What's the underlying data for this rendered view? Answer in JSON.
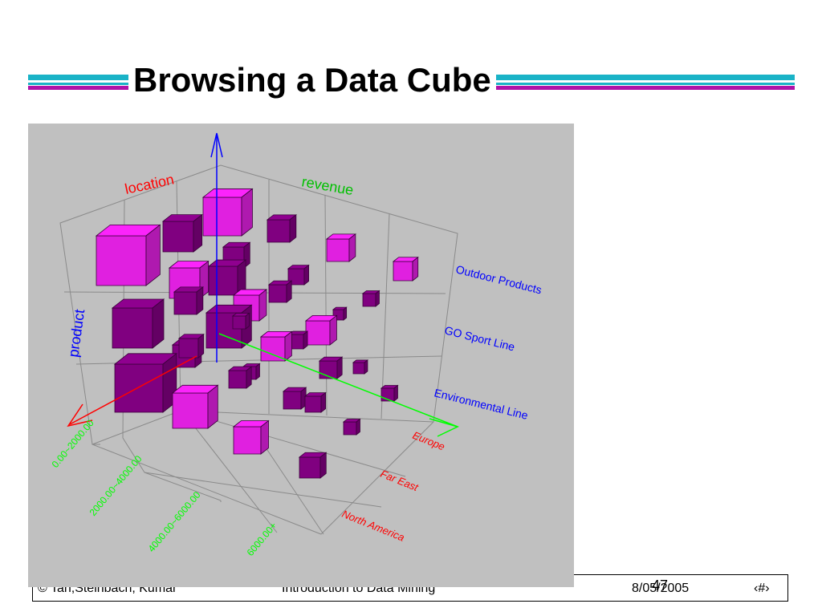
{
  "slide": {
    "title": "Browsing a Data Cube",
    "page_number": "47"
  },
  "footer": {
    "left": "© Tan,Steinbach, Kumar",
    "center": "Introduction to Data Mining",
    "date": "8/05/2005",
    "page": "‹#›"
  },
  "cube": {
    "axis_titles": {
      "location": "location",
      "revenue": "revenue",
      "product": "product"
    },
    "product_labels": [
      "Outdoor Products",
      "GO Sport Line",
      "Environmental Line"
    ],
    "location_labels": [
      "Europe",
      "Far East",
      "North America"
    ],
    "revenue_labels": [
      "0.00~2000.00",
      "2000.00~4000.00",
      "4000.00~6000.00",
      "6000.00+"
    ],
    "colors": {
      "bright": "#e020e0",
      "dark": "#800080",
      "location": "#ff0000",
      "revenue": "#00ff00",
      "product": "#0000ff",
      "grid": "#888888",
      "background": "#c0c0c0"
    }
  }
}
